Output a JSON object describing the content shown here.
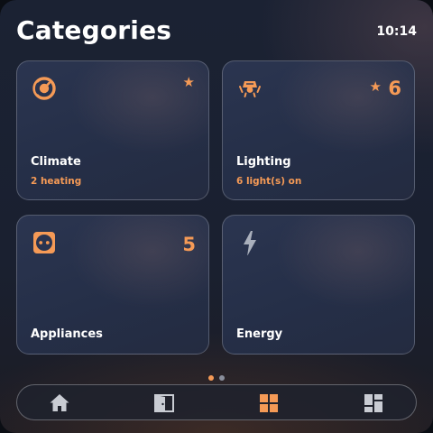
{
  "header": {
    "title": "Categories",
    "time": "10:14"
  },
  "cards": [
    {
      "name": "Climate",
      "status": "2 heating",
      "icon": "thermostat-icon",
      "favorite": true,
      "count": ""
    },
    {
      "name": "Lighting",
      "status": "6 light(s) on",
      "icon": "ceiling-light-icon",
      "favorite": true,
      "count": "6"
    },
    {
      "name": "Appliances",
      "status": "",
      "icon": "power-outlet-icon",
      "favorite": false,
      "count": "5"
    },
    {
      "name": "Energy",
      "status": "",
      "icon": "lightning-bolt-icon",
      "favorite": false,
      "count": ""
    }
  ],
  "pager": {
    "pages": 2,
    "active_page": 1
  },
  "nav": {
    "items": [
      {
        "icon": "home-icon",
        "active": false
      },
      {
        "icon": "door-icon",
        "active": false
      },
      {
        "icon": "grid-icon",
        "active": true
      },
      {
        "icon": "dashboard-icon",
        "active": false
      }
    ]
  },
  "colors": {
    "accent": "#f59a56",
    "text": "#ffffff",
    "inactive_icon": "#c9ccd3"
  }
}
